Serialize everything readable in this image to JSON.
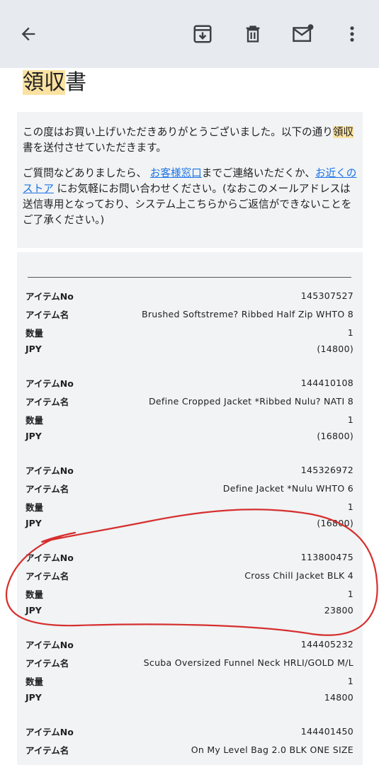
{
  "toolbar": {
    "back_icon": "arrow-back-icon",
    "archive_icon": "archive-icon",
    "delete_icon": "trash-icon",
    "unread_icon": "mark-unread-icon",
    "more_icon": "more-vert-icon"
  },
  "email": {
    "title_hl": "領収",
    "title_rest": "書",
    "intro1_a": "この度はお買い上げいただきありがとうございました。以下の通り",
    "intro1_hl": "領収",
    "intro1_b": "書を送付させていただきます。",
    "intro2_a": "ご質問などありましたら、",
    "intro2_link1": "お客様窓口",
    "intro2_b": "までご連絡いただくか、",
    "intro2_link2": "お近くのストア",
    "intro2_c": "にお気軽にお問い合わせください。(なおこのメールアドレスは送信専用となっており、システム上こちらからご返信ができないことをご了承ください。)"
  },
  "labels": {
    "item_no": "アイテムNo",
    "item_name": "アイテム名",
    "qty": "数量",
    "jpy": "JPY"
  },
  "items": [
    {
      "no": "145307527",
      "name": "Brushed Softstreme? Ribbed Half Zip WHTO 8",
      "qty": "1",
      "price": "(14800)"
    },
    {
      "no": "144410108",
      "name": "Define Cropped Jacket *Ribbed Nulu? NATI 8",
      "qty": "1",
      "price": "(16800)"
    },
    {
      "no": "145326972",
      "name": "Define Jacket *Nulu WHTO 6",
      "qty": "1",
      "price": "(16800)"
    },
    {
      "no": "113800475",
      "name": "Cross Chill Jacket BLK 4",
      "qty": "1",
      "price": "23800"
    },
    {
      "no": "144405232",
      "name": "Scuba Oversized Funnel Neck HRLI/GOLD M/L",
      "qty": "1",
      "price": "14800"
    },
    {
      "no": "144401450",
      "name": "On My Level Bag 2.0 BLK ONE SIZE"
    }
  ],
  "colors": {
    "appbar": "#e7eaef",
    "highlight": "#fbe2a1",
    "link": "#1a73e8",
    "annotation": "#d62f2f"
  }
}
